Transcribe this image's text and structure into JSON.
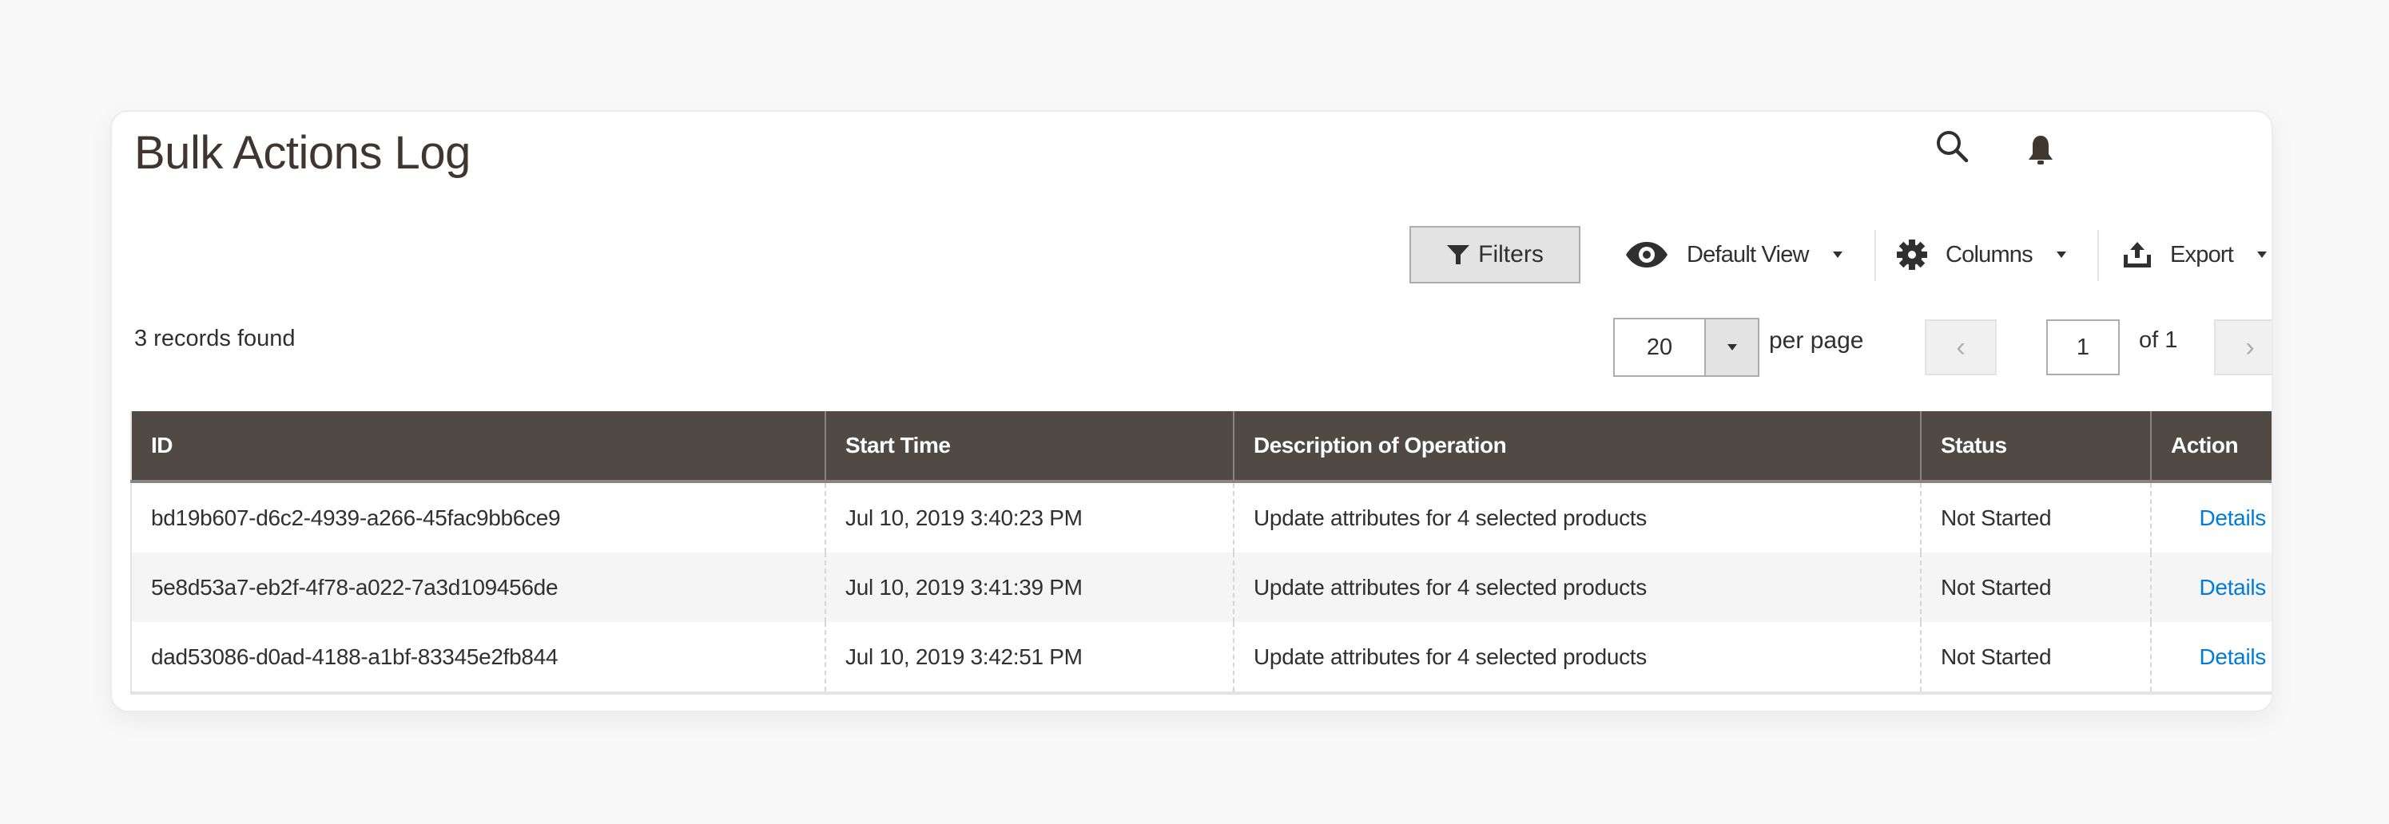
{
  "header": {
    "title": "Bulk Actions Log",
    "icons": {
      "search": "search-icon",
      "notifications": "bell-icon"
    }
  },
  "toolbar": {
    "filters_label": "Filters",
    "view_label": "Default View",
    "columns_label": "Columns",
    "export_label": "Export",
    "icons": {
      "filters": "funnel-icon",
      "view": "eye-icon",
      "columns": "gear-icon",
      "export": "upload-icon"
    }
  },
  "records": {
    "found_text": "3 records found"
  },
  "pagination": {
    "per_page_value": "20",
    "per_page_label": "per page",
    "current_page": "1",
    "of_label": "of 1",
    "prev_glyph": "‹",
    "next_glyph": "›"
  },
  "table": {
    "columns": [
      "ID",
      "Start Time",
      "Description of Operation",
      "Status",
      "Action"
    ],
    "rows": [
      {
        "id": "bd19b607-d6c2-4939-a266-45fac9bb6ce9",
        "start_time": "Jul 10, 2019 3:40:23 PM",
        "description": "Update attributes for 4 selected products",
        "status": "Not Started",
        "action": "Details"
      },
      {
        "id": "5e8d53a7-eb2f-4f78-a022-7a3d109456de",
        "start_time": "Jul 10, 2019 3:41:39 PM",
        "description": "Update attributes for 4 selected products",
        "status": "Not Started",
        "action": "Details"
      },
      {
        "id": "dad53086-d0ad-4188-a1bf-83345e2fb844",
        "start_time": "Jul 10, 2019 3:42:51 PM",
        "description": "Update attributes for 4 selected products",
        "status": "Not Started",
        "action": "Details"
      }
    ]
  },
  "colors": {
    "header_bg": "#514943",
    "link": "#007bdb",
    "title_text": "#41362f"
  }
}
